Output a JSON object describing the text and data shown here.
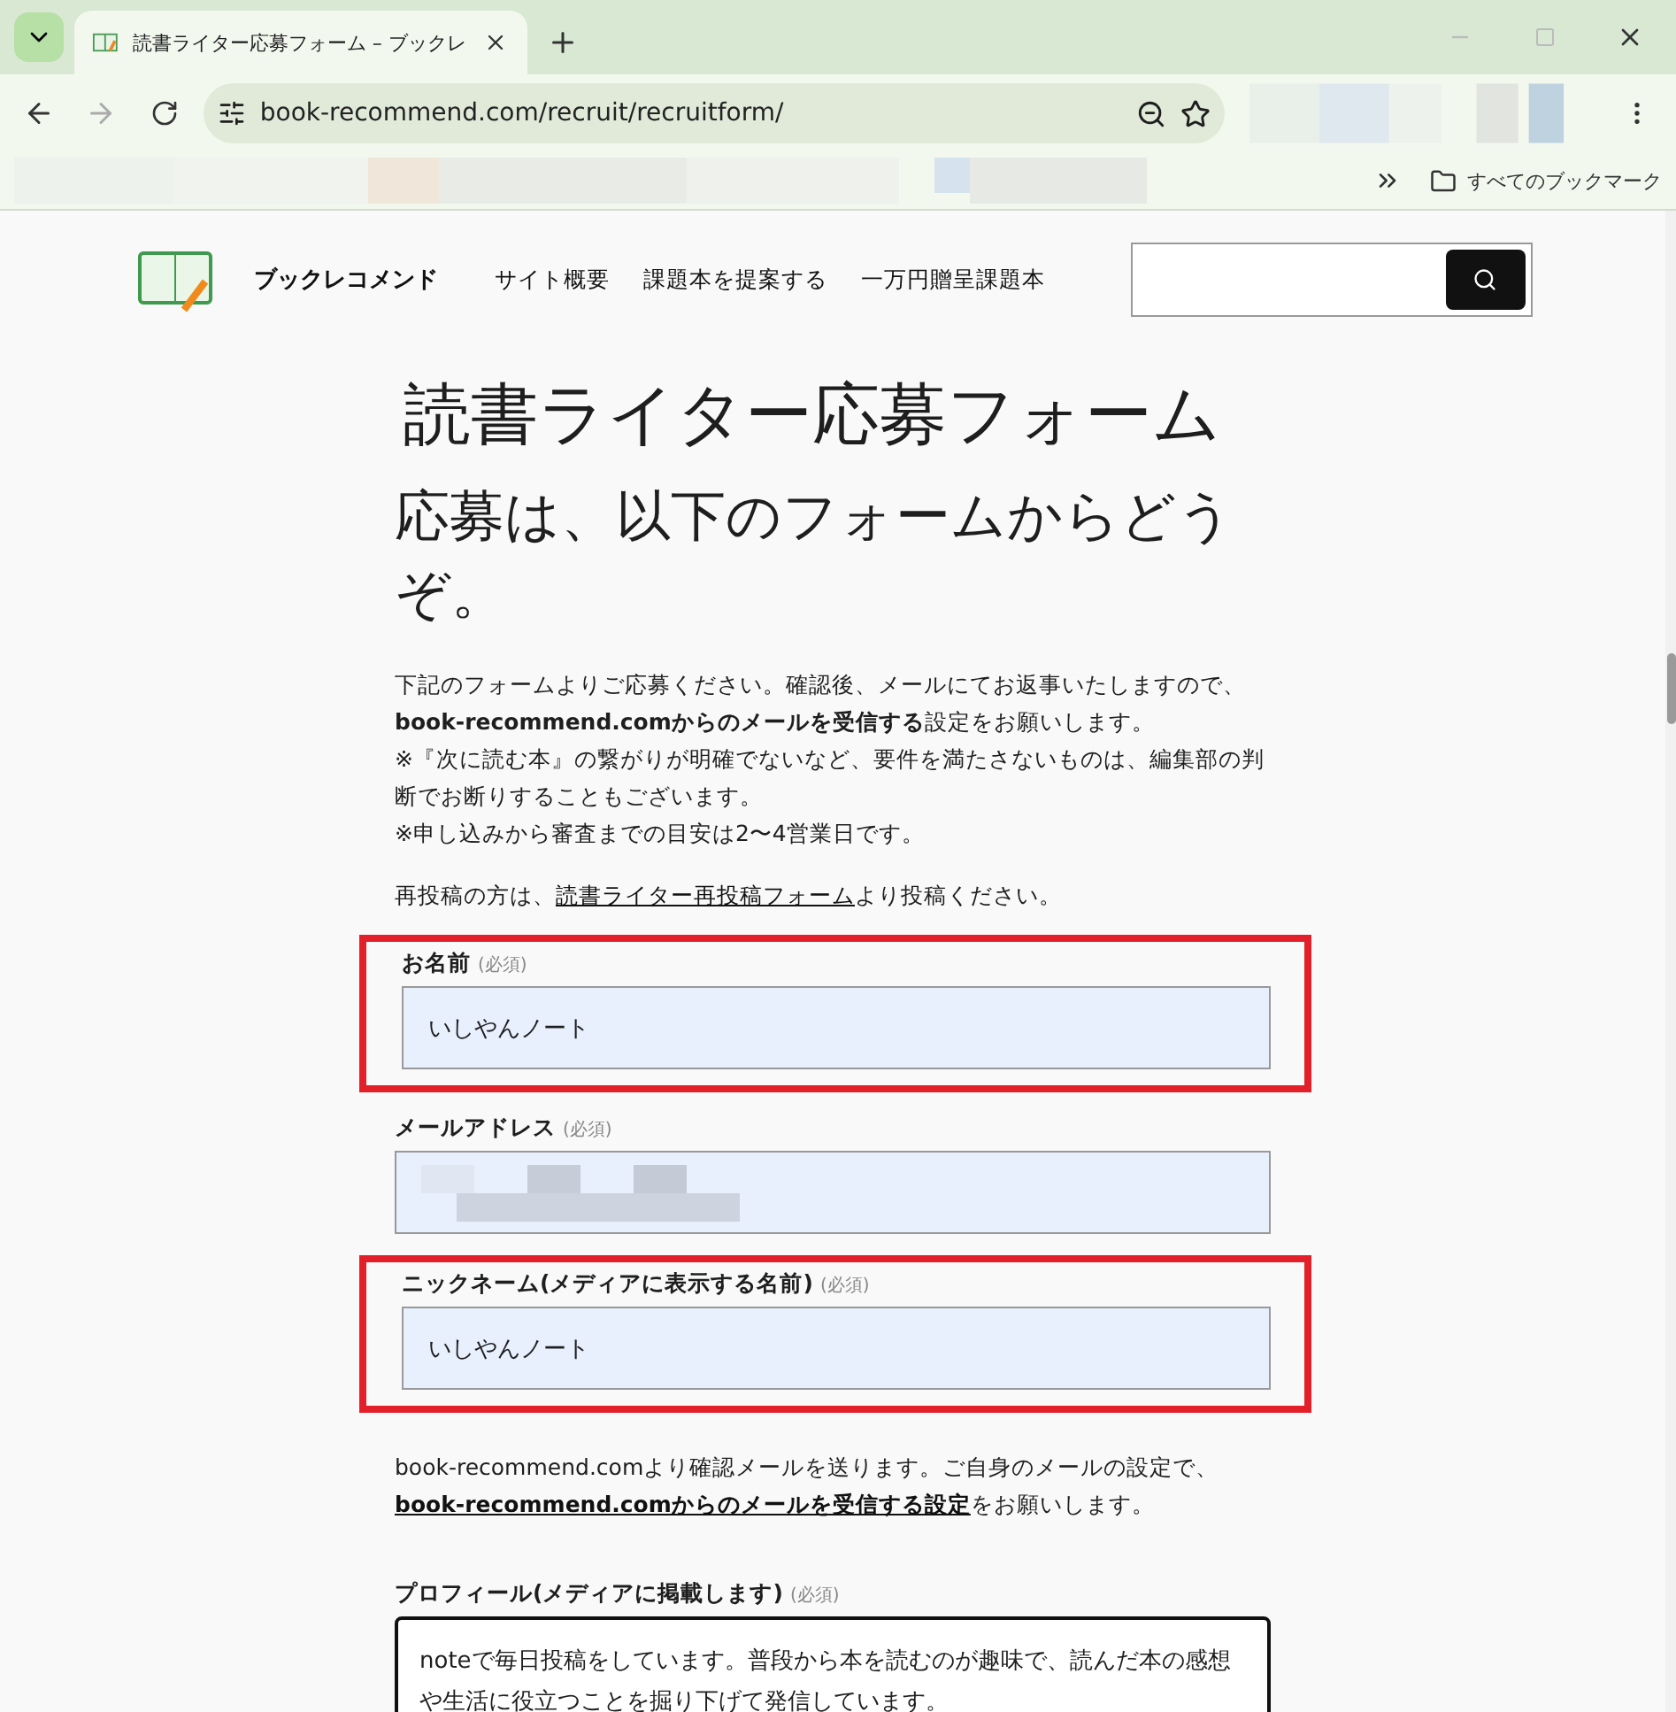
{
  "browser": {
    "tab_title": "読書ライター応募フォーム – ブックレ",
    "url": "book-recommend.com/recruit/recruitform/",
    "bookmarks_folder": "すべてのブックマーク"
  },
  "site": {
    "name": "ブックレコメンド",
    "nav": [
      "サイト概要",
      "課題本を提案する",
      "一万円贈呈課題本"
    ]
  },
  "page": {
    "title": "読書ライター応募フォーム",
    "subtitle": "応募は、以下のフォームからどうぞ。",
    "intro": [
      "下記のフォームよりご応募ください。確認後、メールにてお返事いたしますので、",
      "**book-recommend.comからのメールを受信する**設定をお願いします。",
      "※『次に読む本』の繋がりが明確でないなど、要件を満たさないものは、編集部の判断でお断りすることもございます。",
      "※申し込みから審査までの目安は2〜4営業日です。"
    ],
    "repost": {
      "before": "再投稿の方は、",
      "link": "読書ライター再投稿フォーム",
      "after": "より投稿ください。"
    }
  },
  "form": [
    {
      "kind": "field",
      "label": "お名前",
      "required": "(必須)",
      "value": "いしやんノート",
      "highlighted": true
    },
    {
      "kind": "field-blurred",
      "label": "メールアドレス",
      "required": "(必須)",
      "highlighted": false
    },
    {
      "kind": "field",
      "label": "ニックネーム(メディアに表示する名前)",
      "required": "(必須)",
      "value": "いしやんノート",
      "highlighted": true
    },
    {
      "kind": "note",
      "text": "book-recommend.comより確認メールを送ります。ご自身のメールの設定で、",
      "link": "book-recommend.comからのメールを受信する設定",
      "after": "をお願いします。"
    },
    {
      "kind": "textarea",
      "label": "プロフィール(メディアに掲載します)",
      "required": "(必須)",
      "value": "noteで毎日投稿をしています。普段から本を読むのが趣味で、読んだ本の感想や生活に役立つことを掘り下げて発信しています。",
      "highlighted": false
    }
  ]
}
